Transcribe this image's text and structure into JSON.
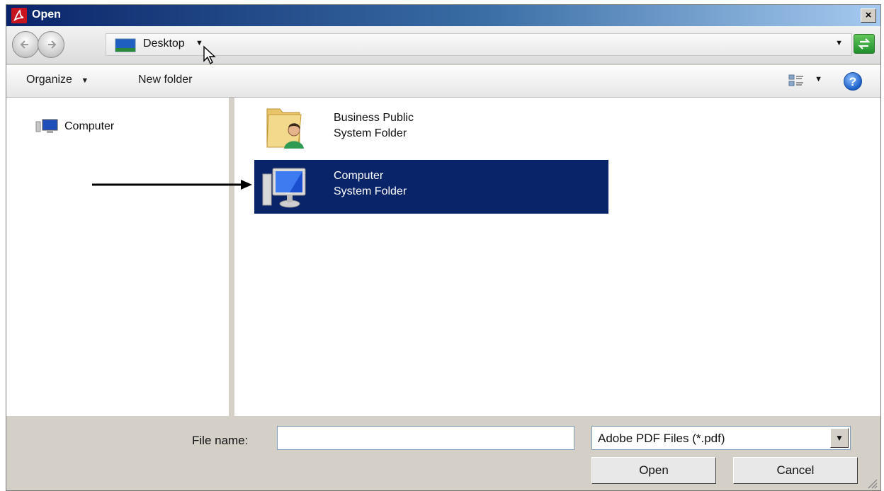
{
  "window": {
    "title": "Open",
    "close_glyph": "×"
  },
  "address": {
    "location": "Desktop",
    "back_icon": "back-arrow-icon",
    "forward_icon": "forward-arrow-icon",
    "refresh_icon": "refresh-icon"
  },
  "toolbar": {
    "organize_label": "Organize",
    "new_folder_label": "New folder",
    "help_glyph": "?"
  },
  "navpane": {
    "items": [
      {
        "label": "Computer",
        "icon": "computer-icon"
      }
    ]
  },
  "content": {
    "items": [
      {
        "name": "Business Public",
        "type": "System Folder",
        "icon": "user-folder-icon",
        "selected": false
      },
      {
        "name": "Computer",
        "type": "System Folder",
        "icon": "computer-monitor-icon",
        "selected": true
      }
    ]
  },
  "footer": {
    "file_name_label": "File name:",
    "file_name_value": "",
    "file_type_selected": "Adobe PDF Files (*.pdf)",
    "open_label": "Open",
    "cancel_label": "Cancel"
  },
  "colors": {
    "selection": "#0a246a",
    "dialog_face": "#d4d0c8",
    "pdf_red": "#c8141e"
  }
}
